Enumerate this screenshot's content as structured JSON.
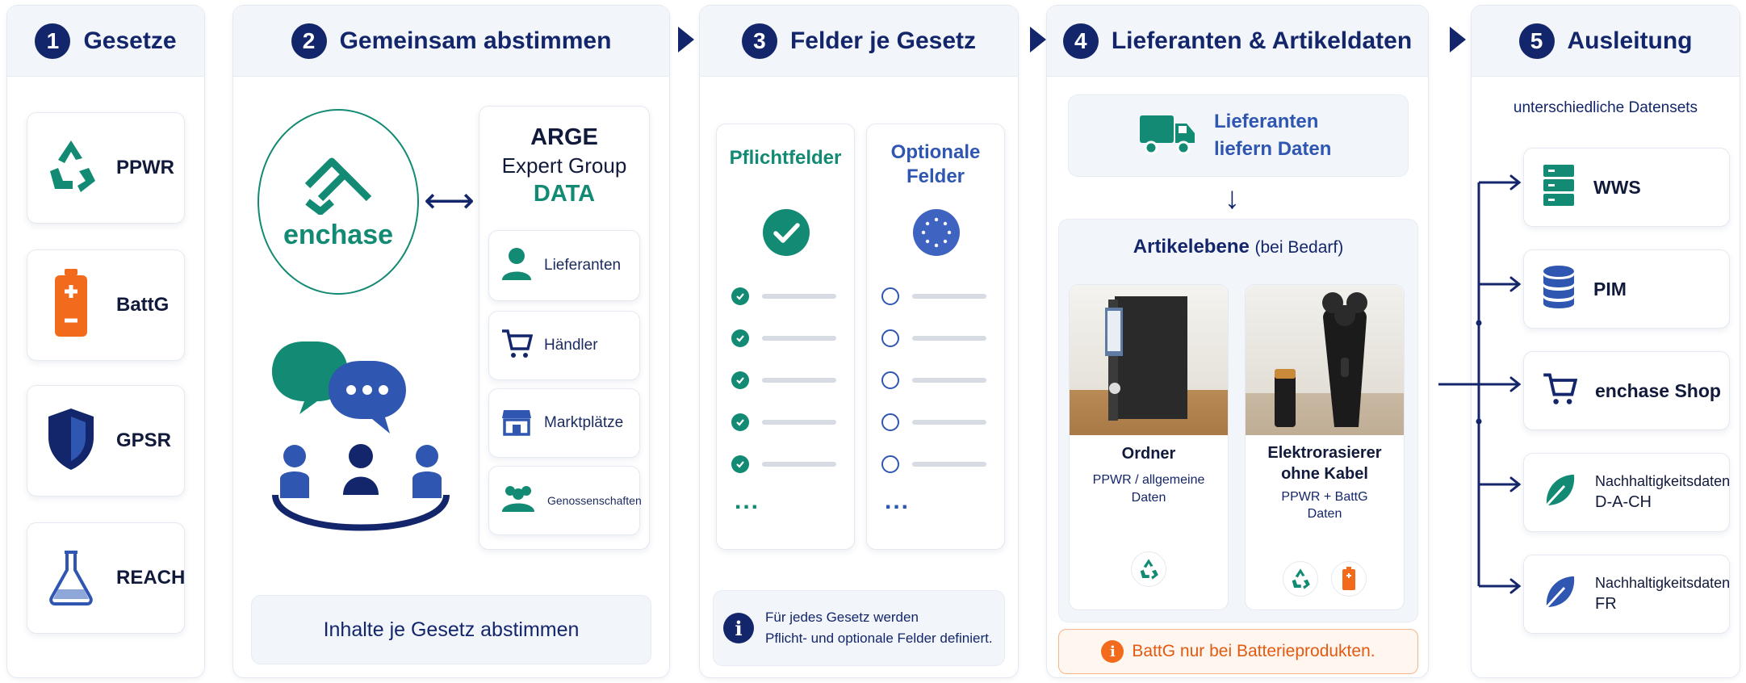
{
  "steps": [
    {
      "num": "1",
      "title": "Gesetze"
    },
    {
      "num": "2",
      "title": "Gemeinsam abstimmen"
    },
    {
      "num": "3",
      "title": "Felder je Gesetz"
    },
    {
      "num": "4",
      "title": "Lieferanten & Artikeldaten"
    },
    {
      "num": "5",
      "title": "Ausleitung"
    }
  ],
  "laws": [
    "PPWR",
    "BattG",
    "GPSR",
    "REACH"
  ],
  "align": {
    "logo_text": "enchase",
    "arge_line1": "ARGE",
    "arge_line2": "Expert Group",
    "arge_line3": "DATA",
    "members": [
      "Lieferanten",
      "Händler",
      "Marktplätze",
      "Genossenschaften"
    ],
    "footer": "Inhalte je Gesetz abstimmen"
  },
  "fields": {
    "mandatory": "Pflichtfelder",
    "optional_line1": "Optionale",
    "optional_line2": "Felder",
    "ellipsis": "...",
    "info_line1": "Für jedes Gesetz werden",
    "info_line2": "Pflicht- und optionale Felder definiert.",
    "info_icon": "i"
  },
  "suppliers": {
    "supplier_line1": "Lieferanten",
    "supplier_line2": "liefern Daten",
    "arrow": "↓",
    "article_level": "Artikelebene",
    "article_level_note": "(bei Bedarf)",
    "products": [
      {
        "name_line1": "Ordner",
        "name_line2": "",
        "laws_line1": "PPWR / allgemeine",
        "laws_line2": "Daten"
      },
      {
        "name_line1": "Elektrorasierer",
        "name_line2": "ohne Kabel",
        "laws_line1": "PPWR + BattG",
        "laws_line2": "Daten"
      }
    ],
    "note": "BattG nur bei Batterieprodukten.",
    "note_icon": "i"
  },
  "output": {
    "subtitle": "unterschiedliche Datensets",
    "targets": [
      {
        "label": "WWS",
        "icon": "server-icon"
      },
      {
        "label": "PIM",
        "icon": "database-icon"
      },
      {
        "label": "enchase Shop",
        "icon": "cart-icon"
      },
      {
        "label_line1": "Nachhaltigkeitsdaten",
        "label_line2": "D-A-CH",
        "icon": "leaf-icon"
      },
      {
        "label_line1": "Nachhaltigkeitsdaten",
        "label_line2": "FR",
        "icon": "leaf-icon"
      }
    ]
  },
  "colors": {
    "navy": "#14266b",
    "teal": "#138a73",
    "blue": "#2f56b0",
    "orange": "#f26a1b",
    "panel_bg": "#f2f5fa"
  },
  "arrows": {
    "double": "⟷"
  }
}
